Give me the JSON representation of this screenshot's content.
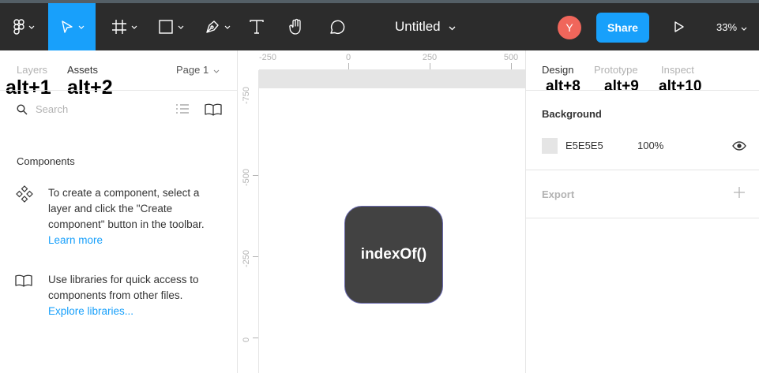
{
  "toolbar": {
    "title": "Untitled",
    "avatar_initial": "Y",
    "share_label": "Share",
    "zoom": "33%",
    "icons": [
      "figma-menu-icon",
      "move-tool-icon",
      "frame-tool-icon",
      "shape-tool-icon",
      "pen-tool-icon",
      "text-tool-icon",
      "hand-tool-icon",
      "comment-tool-icon",
      "present-icon"
    ],
    "accent": "#18a0fb",
    "avatar_color": "#f0665b"
  },
  "left_panel": {
    "tabs": [
      {
        "label": "Layers",
        "shortcut": "alt+1"
      },
      {
        "label": "Assets",
        "shortcut": "alt+2"
      }
    ],
    "page_selector": "Page 1",
    "search_placeholder": "Search",
    "components_title": "Components",
    "components_text": "To create a component, select a layer and click the \"Create component\" button in the toolbar.",
    "components_link": "Learn more",
    "libraries_text": "Use libraries for quick access to components from other files.",
    "libraries_link": "Explore libraries..."
  },
  "canvas": {
    "ruler_top": [
      "-250",
      "0",
      "250",
      "500"
    ],
    "ruler_left": [
      "-750",
      "-500",
      "-250",
      "0"
    ],
    "node_label": "indexOf()"
  },
  "right_panel": {
    "tabs": [
      {
        "label": "Design",
        "shortcut": "alt+8"
      },
      {
        "label": "Prototype",
        "shortcut": "alt+9"
      },
      {
        "label": "Inspect",
        "shortcut": "alt+10"
      }
    ],
    "background_title": "Background",
    "background_hex": "E5E5E5",
    "background_opacity": "100%",
    "export_title": "Export"
  }
}
